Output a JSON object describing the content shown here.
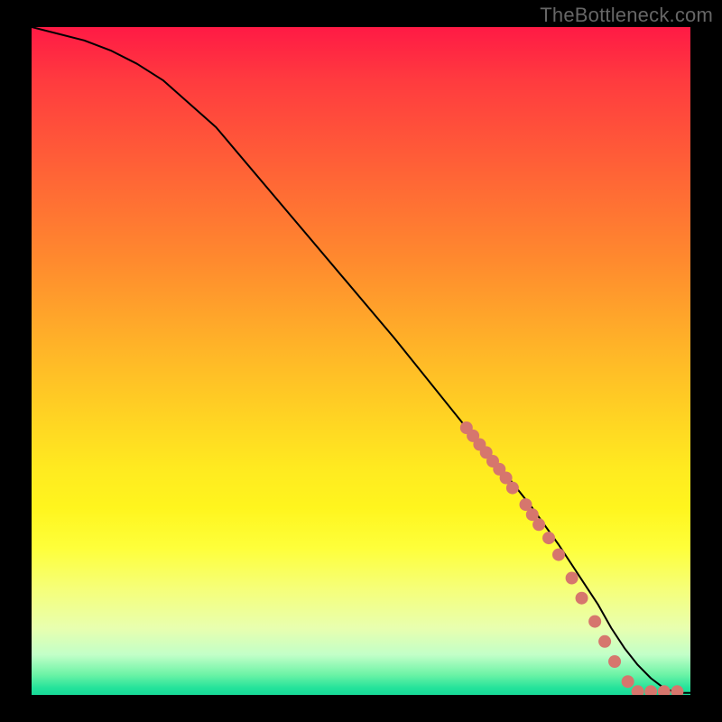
{
  "watermark": "TheBottleneck.com",
  "chart_data": {
    "type": "line",
    "title": "",
    "xlabel": "",
    "ylabel": "",
    "xlim": [
      0,
      100
    ],
    "ylim": [
      0,
      100
    ],
    "grid": false,
    "legend": false,
    "series": [
      {
        "name": "curve",
        "style": "line",
        "color": "#000000",
        "x": [
          0,
          4,
          8,
          12,
          16,
          20,
          28,
          40,
          55,
          66,
          72,
          76,
          80,
          83,
          86,
          88,
          90,
          92,
          94,
          96,
          98,
          100
        ],
        "y": [
          100,
          99,
          98,
          96.5,
          94.5,
          92,
          85,
          71,
          53.5,
          40,
          33,
          28,
          22.5,
          18,
          13.5,
          10,
          7,
          4.5,
          2.5,
          1,
          0.3,
          0.3
        ]
      },
      {
        "name": "markers",
        "style": "scatter",
        "color": "#d6766d",
        "x": [
          66,
          67,
          68,
          69,
          70,
          71,
          72,
          73,
          75,
          76,
          77,
          78.5,
          80,
          82,
          83.5,
          85.5,
          87,
          88.5,
          90.5,
          92,
          94,
          96,
          98
        ],
        "y": [
          40,
          38.8,
          37.5,
          36.3,
          35,
          33.8,
          32.5,
          31,
          28.5,
          27,
          25.5,
          23.5,
          21,
          17.5,
          14.5,
          11,
          8,
          5,
          2,
          0.5,
          0.5,
          0.5,
          0.5
        ]
      }
    ],
    "background_gradient": {
      "direction": "vertical",
      "stops": [
        {
          "pos": 0.0,
          "color": "#ff1a45"
        },
        {
          "pos": 0.22,
          "color": "#ff6436"
        },
        {
          "pos": 0.48,
          "color": "#ffb428"
        },
        {
          "pos": 0.72,
          "color": "#fff51e"
        },
        {
          "pos": 0.9,
          "color": "#e8ffaf"
        },
        {
          "pos": 0.99,
          "color": "#23e29a"
        },
        {
          "pos": 1.0,
          "color": "#17d997"
        }
      ]
    }
  }
}
